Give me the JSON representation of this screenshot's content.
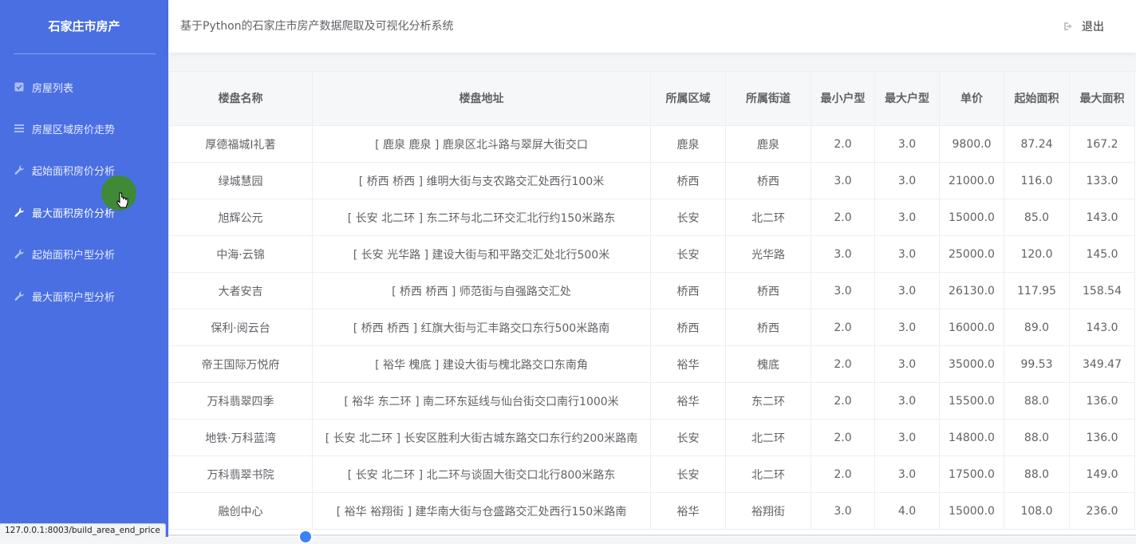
{
  "brand": "石家庄市房产",
  "header": {
    "title": "基于Python的石家庄市房产数据爬取及可视化分析系统",
    "logout": "退出"
  },
  "sidebar": {
    "items": [
      {
        "label": "房屋列表",
        "icon": "checkbox-icon"
      },
      {
        "label": "房屋区域房价走势",
        "icon": "list-icon"
      },
      {
        "label": "起始面积房价分析",
        "icon": "wrench-icon"
      },
      {
        "label": "最大面积房价分析",
        "icon": "wrench-icon",
        "active": true
      },
      {
        "label": "起始面积户型分析",
        "icon": "wrench-icon"
      },
      {
        "label": "最大面积户型分析",
        "icon": "wrench-icon"
      }
    ]
  },
  "status_url": "127.0.0.1:8003/build_area_end_price",
  "table": {
    "headers": [
      "楼盘名称",
      "楼盘地址",
      "所属区域",
      "所属街道",
      "最小户型",
      "最大户型",
      "单价",
      "起始面积",
      "最大面积"
    ],
    "rows": [
      [
        "厚德福城I礼著",
        "[ 鹿泉 鹿泉 ] 鹿泉区北斗路与翠屏大街交口",
        "鹿泉",
        "鹿泉",
        "2.0",
        "3.0",
        "9800.0",
        "87.24",
        "167.2"
      ],
      [
        "绿城慧园",
        "[ 桥西 桥西 ] 维明大街与支农路交汇处西行100米",
        "桥西",
        "桥西",
        "3.0",
        "3.0",
        "21000.0",
        "116.0",
        "133.0"
      ],
      [
        "旭辉公元",
        "[ 长安 北二环 ] 东二环与北二环交汇北行约150米路东",
        "长安",
        "北二环",
        "2.0",
        "3.0",
        "15000.0",
        "85.0",
        "143.0"
      ],
      [
        "中海·云锦",
        "[ 长安 光华路 ] 建设大街与和平路交汇处北行500米",
        "长安",
        "光华路",
        "3.0",
        "3.0",
        "25000.0",
        "120.0",
        "145.0"
      ],
      [
        "大者安吉",
        "[ 桥西 桥西 ] 师范街与自强路交汇处",
        "桥西",
        "桥西",
        "3.0",
        "3.0",
        "26130.0",
        "117.95",
        "158.54"
      ],
      [
        "保利·阅云台",
        "[ 桥西 桥西 ] 红旗大街与汇丰路交口东行500米路南",
        "桥西",
        "桥西",
        "2.0",
        "3.0",
        "16000.0",
        "89.0",
        "143.0"
      ],
      [
        "帝王国际万悦府",
        "[ 裕华 槐底 ] 建设大街与槐北路交口东南角",
        "裕华",
        "槐底",
        "2.0",
        "3.0",
        "35000.0",
        "99.53",
        "349.47"
      ],
      [
        "万科翡翠四季",
        "[ 裕华 东二环 ] 南二环东延线与仙台街交口南行1000米",
        "裕华",
        "东二环",
        "2.0",
        "3.0",
        "15500.0",
        "88.0",
        "136.0"
      ],
      [
        "地铁·万科蓝湾",
        "[ 长安 北二环 ] 长安区胜利大街古城东路交口东行约200米路南",
        "长安",
        "北二环",
        "2.0",
        "3.0",
        "14800.0",
        "88.0",
        "136.0"
      ],
      [
        "万科翡翠书院",
        "[ 长安 北二环 ] 北二环与谈固大街交口北行800米路东",
        "长安",
        "北二环",
        "2.0",
        "3.0",
        "17500.0",
        "88.0",
        "149.0"
      ],
      [
        "融创中心",
        "[ 裕华 裕翔街 ] 建华南大街与仓盛路交汇处西行150米路南",
        "裕华",
        "裕翔街",
        "3.0",
        "4.0",
        "15000.0",
        "108.0",
        "236.0"
      ]
    ]
  }
}
